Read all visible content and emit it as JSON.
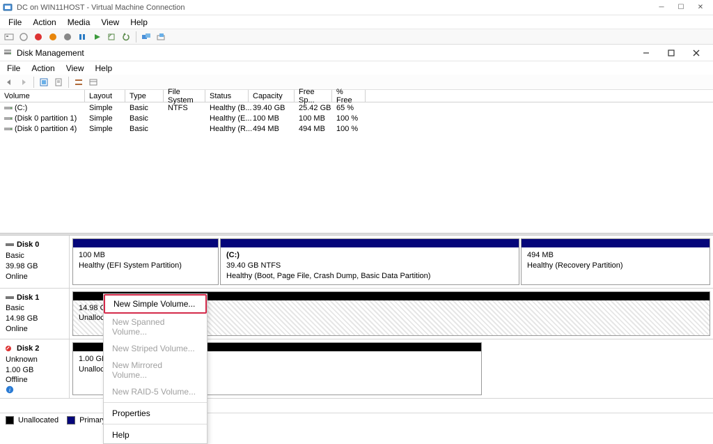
{
  "vm": {
    "title": "DC on WIN11HOST - Virtual Machine Connection",
    "menu": {
      "file": "File",
      "action": "Action",
      "media": "Media",
      "view": "View",
      "help": "Help"
    }
  },
  "dm": {
    "title": "Disk Management",
    "menu": {
      "file": "File",
      "action": "Action",
      "view": "View",
      "help": "Help"
    }
  },
  "columns": {
    "volume": "Volume",
    "layout": "Layout",
    "type": "Type",
    "fs": "File System",
    "status": "Status",
    "capacity": "Capacity",
    "free": "Free Sp...",
    "pfree": "% Free"
  },
  "volumes": [
    {
      "name": "(C:)",
      "layout": "Simple",
      "type": "Basic",
      "fs": "NTFS",
      "status": "Healthy (B...",
      "capacity": "39.40 GB",
      "free": "25.42 GB",
      "pfree": "65 %"
    },
    {
      "name": "(Disk 0 partition 1)",
      "layout": "Simple",
      "type": "Basic",
      "fs": "",
      "status": "Healthy (E...",
      "capacity": "100 MB",
      "free": "100 MB",
      "pfree": "100 %"
    },
    {
      "name": "(Disk 0 partition 4)",
      "layout": "Simple",
      "type": "Basic",
      "fs": "",
      "status": "Healthy (R...",
      "capacity": "494 MB",
      "free": "494 MB",
      "pfree": "100 %"
    }
  ],
  "disks": {
    "d0": {
      "name": "Disk 0",
      "type": "Basic",
      "size": "39.98 GB",
      "status": "Online",
      "p1": {
        "size": "100 MB",
        "desc": "Healthy (EFI System Partition)"
      },
      "p2": {
        "label": "(C:)",
        "size": "39.40 GB NTFS",
        "desc": "Healthy (Boot, Page File, Crash Dump, Basic Data Partition)"
      },
      "p3": {
        "size": "494 MB",
        "desc": "Healthy (Recovery Partition)"
      }
    },
    "d1": {
      "name": "Disk 1",
      "type": "Basic",
      "size": "14.98 GB",
      "status": "Online",
      "p1": {
        "size": "14.98 GB",
        "desc": "Unallocated"
      }
    },
    "d2": {
      "name": "Disk 2",
      "type": "Unknown",
      "size": "1.00 GB",
      "status": "Offline",
      "p1": {
        "size": "1.00 GB",
        "desc": "Unallocated"
      }
    }
  },
  "legend": {
    "unalloc": "Unallocated",
    "primary": "Primary partition"
  },
  "ctx": {
    "new_simple": "New Simple Volume...",
    "new_spanned": "New Spanned Volume...",
    "new_striped": "New Striped Volume...",
    "new_mirrored": "New Mirrored Volume...",
    "new_raid5": "New RAID-5 Volume...",
    "properties": "Properties",
    "help": "Help"
  }
}
